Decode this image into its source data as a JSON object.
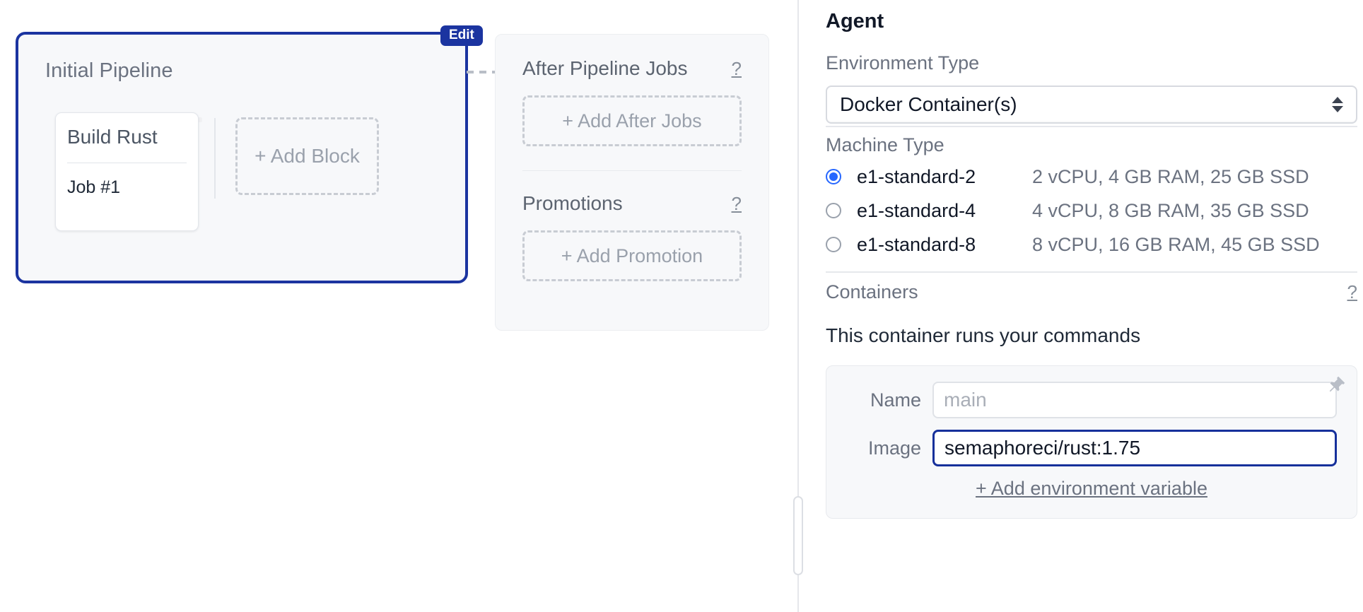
{
  "workflow": {
    "pipeline": {
      "title": "Initial Pipeline",
      "edit_badge": "Edit",
      "block": {
        "name": "Build Rust",
        "job": "Job #1"
      },
      "add_block_label": "+ Add Block"
    },
    "after_pipeline": {
      "title": "After Pipeline Jobs",
      "help": "?",
      "add_label": "+ Add After Jobs"
    },
    "promotions": {
      "title": "Promotions",
      "help": "?",
      "add_label": "+ Add Promotion"
    }
  },
  "agent": {
    "title": "Agent",
    "environment": {
      "label": "Environment Type",
      "selected": "Docker Container(s)"
    },
    "machine": {
      "label": "Machine Type",
      "options": [
        {
          "name": "e1-standard-2",
          "spec": "2 vCPU, 4 GB RAM, 25 GB SSD",
          "selected": true
        },
        {
          "name": "e1-standard-4",
          "spec": "4 vCPU, 8 GB RAM, 35 GB SSD",
          "selected": false
        },
        {
          "name": "e1-standard-8",
          "spec": "8 vCPU, 16 GB RAM, 45 GB SSD",
          "selected": false
        }
      ]
    },
    "containers": {
      "label": "Containers",
      "help": "?",
      "subtitle": "This container runs your commands",
      "name_label": "Name",
      "name_placeholder": "main",
      "name_value": "",
      "image_label": "Image",
      "image_value": "semaphoreci/rust:1.75",
      "add_env_label": "+ Add environment variable",
      "pin_icon": "pin-icon"
    }
  },
  "colors": {
    "accent_blue": "#1b34a0",
    "radio_blue": "#2667ff",
    "focus_border": "#16309b",
    "panel_bg": "#f7f8fa",
    "muted_text": "#6b7280"
  }
}
